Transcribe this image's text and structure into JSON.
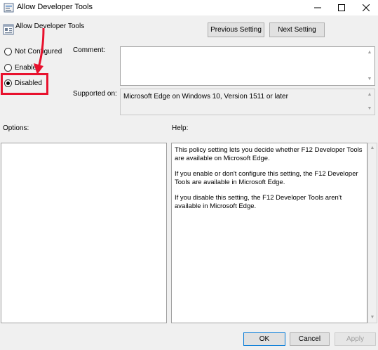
{
  "window": {
    "title": "Allow Developer Tools",
    "minimize": "—",
    "maximize": "☐",
    "close": "✕"
  },
  "policy": {
    "name": "Allow Developer Tools"
  },
  "navigation": {
    "previous_label": "Previous Setting",
    "next_label": "Next Setting"
  },
  "state": {
    "options": [
      {
        "label": "Not Configured",
        "checked": false
      },
      {
        "label": "Enabled",
        "checked": false
      },
      {
        "label": "Disabled",
        "checked": true
      }
    ]
  },
  "fields": {
    "comment_label": "Comment:",
    "comment_value": "",
    "supported_label": "Supported on:",
    "supported_value": "Microsoft Edge on Windows 10, Version 1511 or later",
    "options_label": "Options:",
    "help_label": "Help:"
  },
  "help": {
    "paragraphs": [
      "This policy setting lets you decide whether F12 Developer Tools are available on Microsoft Edge.",
      "If you enable or don't configure this setting, the F12 Developer Tools are available in Microsoft Edge.",
      "If you disable this setting, the F12 Developer Tools aren't available in Microsoft Edge."
    ]
  },
  "buttons": {
    "ok": "OK",
    "cancel": "Cancel",
    "apply": "Apply"
  },
  "colors": {
    "annotation": "#e8112d"
  }
}
